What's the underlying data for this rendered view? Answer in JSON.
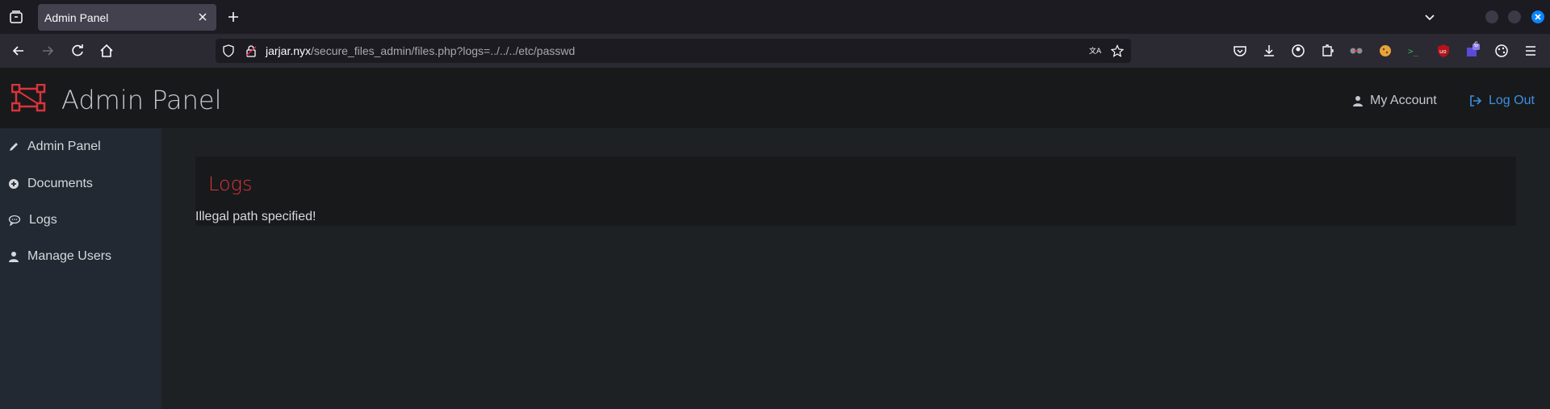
{
  "browser": {
    "tab_title": "Admin Panel",
    "url_host": "jarjar.nyx",
    "url_path": "/secure_files_admin/files.php?logs=../../../etc/passwd",
    "extension_badge": "6"
  },
  "header": {
    "brand": "Admin Panel",
    "my_account": "My Account",
    "logout": "Log Out"
  },
  "sidebar": {
    "items": [
      {
        "label": "Admin Panel",
        "icon": "pencil-icon"
      },
      {
        "label": "Documents",
        "icon": "plus-circle-icon"
      },
      {
        "label": "Logs",
        "icon": "comment-icon"
      },
      {
        "label": "Manage Users",
        "icon": "user-icon"
      }
    ]
  },
  "content": {
    "title": "Logs",
    "message": "Illegal path specified!"
  },
  "colors": {
    "accent_red": "#d9343a",
    "link_blue": "#3d8fe0"
  }
}
